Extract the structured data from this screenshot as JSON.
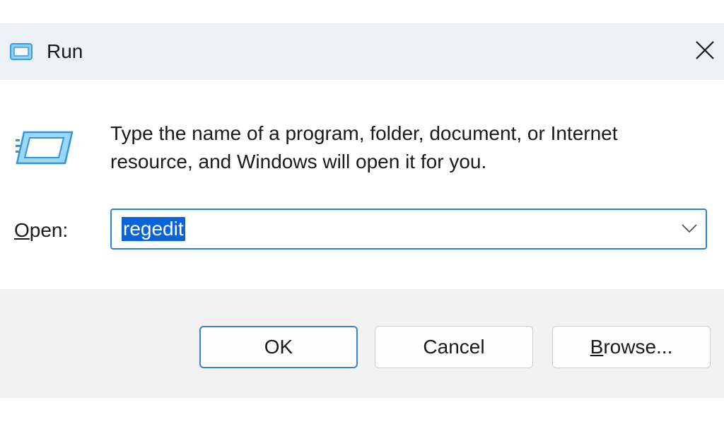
{
  "window": {
    "title": "Run",
    "icon": "run-icon",
    "close_icon": "close-icon"
  },
  "content": {
    "description_line1": "Type the name of a program, folder, document, or Internet",
    "description_line2": "resource, and Windows will open it for you.",
    "open_label_accel": "O",
    "open_label_rest": "pen:",
    "open_value": "regedit",
    "dropdown_icon": "chevron-down-icon"
  },
  "buttons": {
    "ok": "OK",
    "cancel": "Cancel",
    "browse_accel": "B",
    "browse_rest": "rowse..."
  },
  "colors": {
    "titlebar_bg": "#ecf1f7",
    "accent": "#0a64d7",
    "footer_bg": "#f2f2f2"
  }
}
